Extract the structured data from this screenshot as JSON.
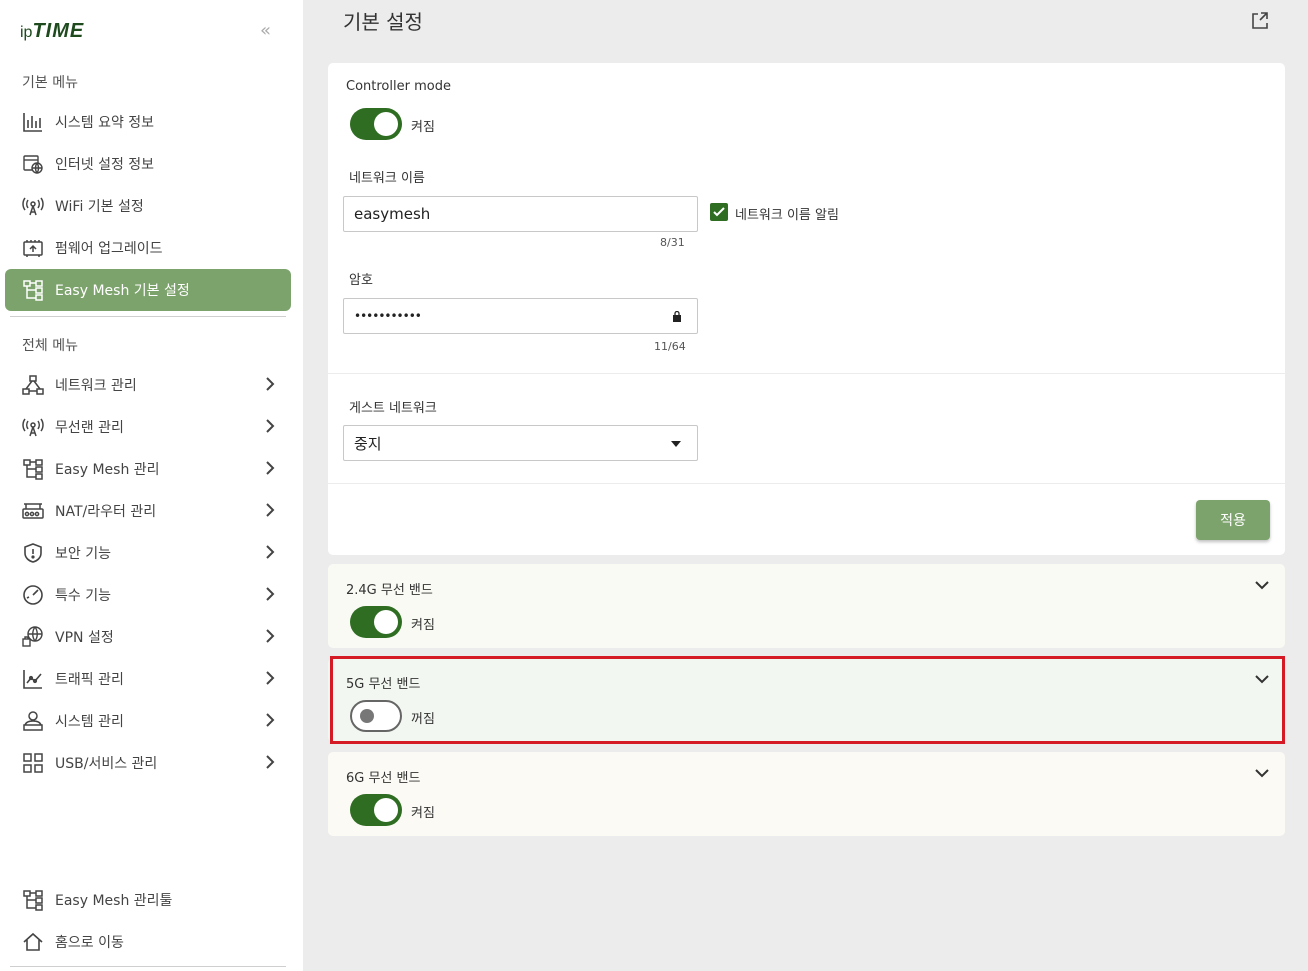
{
  "brand": {
    "ip": "ip",
    "time": "TIME"
  },
  "sidebar": {
    "collapse_glyph": "«",
    "basic_title": "기본 메뉴",
    "basic_items": [
      {
        "label": "시스템 요약 정보",
        "icon": "bar-chart-icon"
      },
      {
        "label": "인터넷 설정 정보",
        "icon": "globe-doc-icon"
      },
      {
        "label": "WiFi 기본 설정",
        "icon": "wifi-antenna-icon"
      },
      {
        "label": "펌웨어 업그레이드",
        "icon": "firmware-icon"
      },
      {
        "label": "Easy Mesh 기본 설정",
        "icon": "mesh-icon",
        "active": true
      }
    ],
    "all_title": "전체 메뉴",
    "all_items": [
      {
        "label": "네트워크 관리",
        "icon": "network-icon"
      },
      {
        "label": "무선랜 관리",
        "icon": "wifi-antenna-icon"
      },
      {
        "label": "Easy Mesh 관리",
        "icon": "mesh-icon"
      },
      {
        "label": "NAT/라우터 관리",
        "icon": "router-icon"
      },
      {
        "label": "보안 기능",
        "icon": "shield-icon"
      },
      {
        "label": "특수 기능",
        "icon": "gauge-icon"
      },
      {
        "label": "VPN 설정",
        "icon": "vpn-globe-icon"
      },
      {
        "label": "트래픽 관리",
        "icon": "traffic-chart-icon"
      },
      {
        "label": "시스템 관리",
        "icon": "system-user-icon"
      },
      {
        "label": "USB/서비스 관리",
        "icon": "usb-grid-icon"
      }
    ],
    "bottom_items": [
      {
        "label": "Easy Mesh 관리툴",
        "icon": "mesh-icon"
      },
      {
        "label": "홈으로 이동",
        "icon": "home-icon"
      }
    ]
  },
  "main": {
    "title": "기본 설정",
    "controller_mode": {
      "label": "Controller mode",
      "state": "켜짐"
    },
    "network_name": {
      "label": "네트워크 이름",
      "value": "easymesh",
      "counter": "8/31",
      "broadcast_label": "네트워크 이름 알림"
    },
    "password": {
      "label": "암호",
      "value": "•••••••••••",
      "counter": "11/64"
    },
    "guest": {
      "label": "게스트 네트워크",
      "value": "중지"
    },
    "apply_label": "적용",
    "bands": [
      {
        "title": "2.4G 무선 밴드",
        "state": "켜짐",
        "on": true
      },
      {
        "title": "5G 무선 밴드",
        "state": "꺼짐",
        "on": false
      },
      {
        "title": "6G 무선 밴드",
        "state": "켜짐",
        "on": true
      }
    ]
  },
  "colors": {
    "accent": "#7da36d",
    "toggle_on": "#2f6e22",
    "highlight": "#d61a25"
  }
}
